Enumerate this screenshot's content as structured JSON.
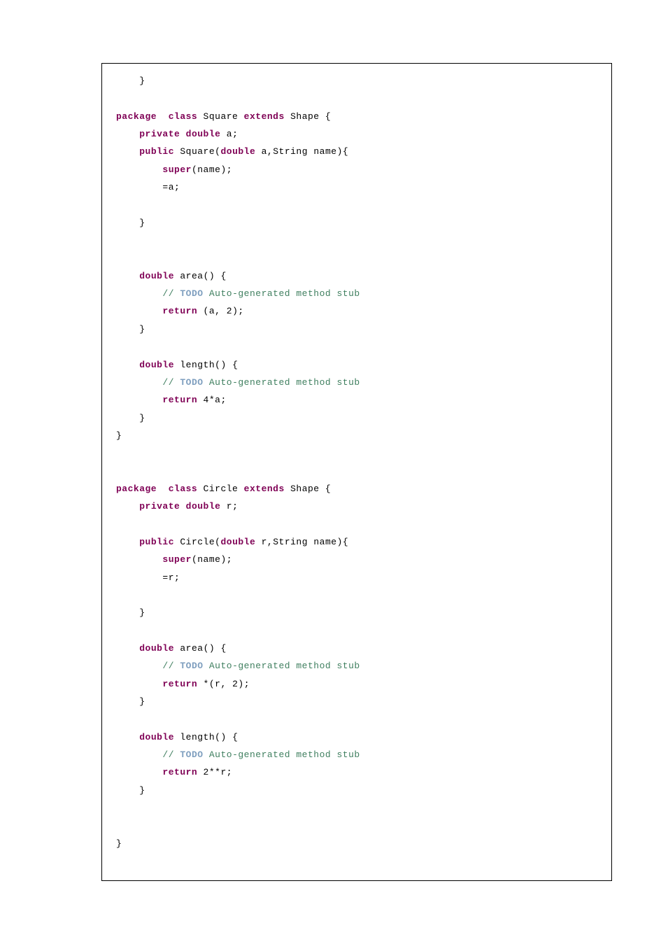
{
  "code": {
    "k_package": "package",
    "k_class": "class",
    "k_extends": "extends",
    "k_private": "private",
    "k_public": "public",
    "k_double": "double",
    "k_super": "super",
    "k_return": "return",
    "t_todo": "TODO",
    "c_todo_text": " Auto-generated method stub",
    "id_square": "Square",
    "id_circle": "Circle",
    "id_shape": "Shape",
    "id_area": "area",
    "id_length": "length",
    "id_string": "String",
    "id_name": "name",
    "id_a": "a",
    "id_r": "r",
    "brace_open": "{",
    "brace_close": "}",
    "paren_open": "(",
    "paren_close": ")",
    "comma": ",",
    "semi": ";",
    "eq": "=",
    "star": "*",
    "sl": "//",
    "n2": "2",
    "n4": "4",
    "sp": " "
  }
}
